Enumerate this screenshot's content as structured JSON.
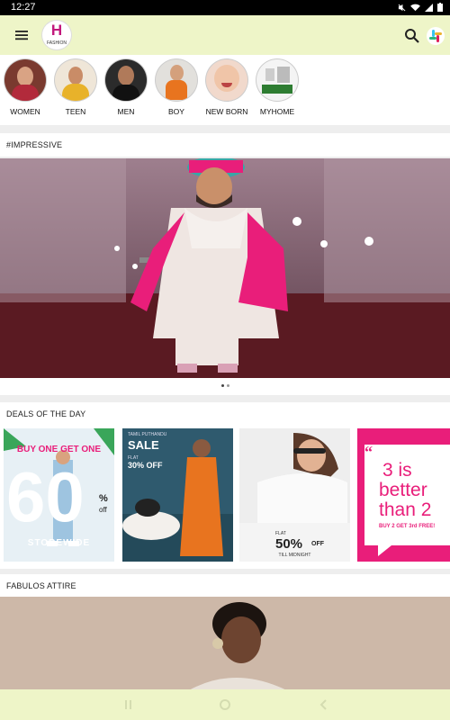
{
  "status_bar": {
    "time": "12:27"
  },
  "app_bar": {
    "logo_letter": "H",
    "logo_sub": "FASHION"
  },
  "categories": [
    {
      "label": "WOMEN",
      "bg": "#7a3a2f"
    },
    {
      "label": "TEEN",
      "bg": "#e8b25a"
    },
    {
      "label": "MEN",
      "bg": "#2b2b2b"
    },
    {
      "label": "BOY",
      "bg": "#e2e0dc"
    },
    {
      "label": "NEW BORN",
      "bg": "#f1d9cc"
    },
    {
      "label": "MYHOME",
      "bg": "#f4f4f4"
    }
  ],
  "sections": {
    "impressive": "#IMPRESSIVE",
    "deals": "DEALS OF THE DAY",
    "attire": "FABULOS ATTIRE"
  },
  "deals": [
    {
      "top_text": "BUY ONE GET ONE",
      "big_text": "60",
      "pct": "%",
      "off": "off",
      "bottom_text": "STOREWIDE",
      "bg": "#e7f0f5"
    },
    {
      "top_text": "TAMIL PUTHANDU",
      "headline": "SALE",
      "flat": "FLAT",
      "discount": "30% OFF",
      "bg": "#2f5a6e"
    },
    {
      "flat": "FLAT",
      "discount": "50%",
      "off": "OFF",
      "bottom_text": "TILL MIDNIGHT",
      "bg": "#eeeeee"
    },
    {
      "line1": "3 is",
      "line2": "better",
      "line3": "than 2",
      "small": "BUY 2 GET 3rd FREE!",
      "bg": "#e91e7a"
    }
  ]
}
